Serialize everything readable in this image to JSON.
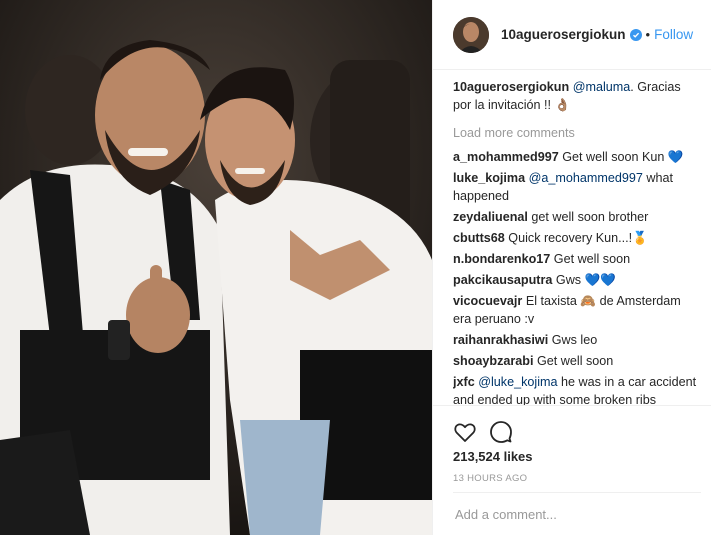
{
  "post": {
    "username": "10aguerosergiokun",
    "follow_label": "Follow",
    "separator": "•"
  },
  "caption": {
    "user": "10aguerosergiokun",
    "mention": "@maluma",
    "text": ". Gracias por la invitación !! 👌🏽"
  },
  "load_more": "Load more comments",
  "comments": [
    {
      "user": "a_mohammed997",
      "mention": "",
      "text": "Get well soon Kun 💙"
    },
    {
      "user": "luke_kojima",
      "mention": "@a_mohammed997",
      "text": "what happened"
    },
    {
      "user": "zeydaliuenal",
      "mention": "",
      "text": "get well soon brother"
    },
    {
      "user": "cbutts68",
      "mention": "",
      "text": "Quick recovery Kun...!🏅"
    },
    {
      "user": "n.bondarenko17",
      "mention": "",
      "text": "Get well soon"
    },
    {
      "user": "pakcikausaputra",
      "mention": "",
      "text": "Gws 💙💙"
    },
    {
      "user": "vicocuevajr",
      "mention": "",
      "text": "El taxista 🙈 de Amsterdam era peruano :v"
    },
    {
      "user": "raihanrakhasiwi",
      "mention": "",
      "text": "Gws leo"
    },
    {
      "user": "shoaybzarabi",
      "mention": "",
      "text": "Get well soon"
    },
    {
      "user": "jxfc",
      "mention": "@luke_kojima",
      "text": "he was in a car accident and ended up with some broken ribs"
    }
  ],
  "likes": "213,524 likes",
  "time_ago": "13 HOURS AGO",
  "add_comment_placeholder": "Add a comment...",
  "icons": {
    "like": "heart-icon",
    "comment": "comment-icon",
    "verified": "verified-badge-icon"
  },
  "colors": {
    "link_blue": "#3897f0",
    "mention_blue": "#003569",
    "muted": "#999999"
  }
}
